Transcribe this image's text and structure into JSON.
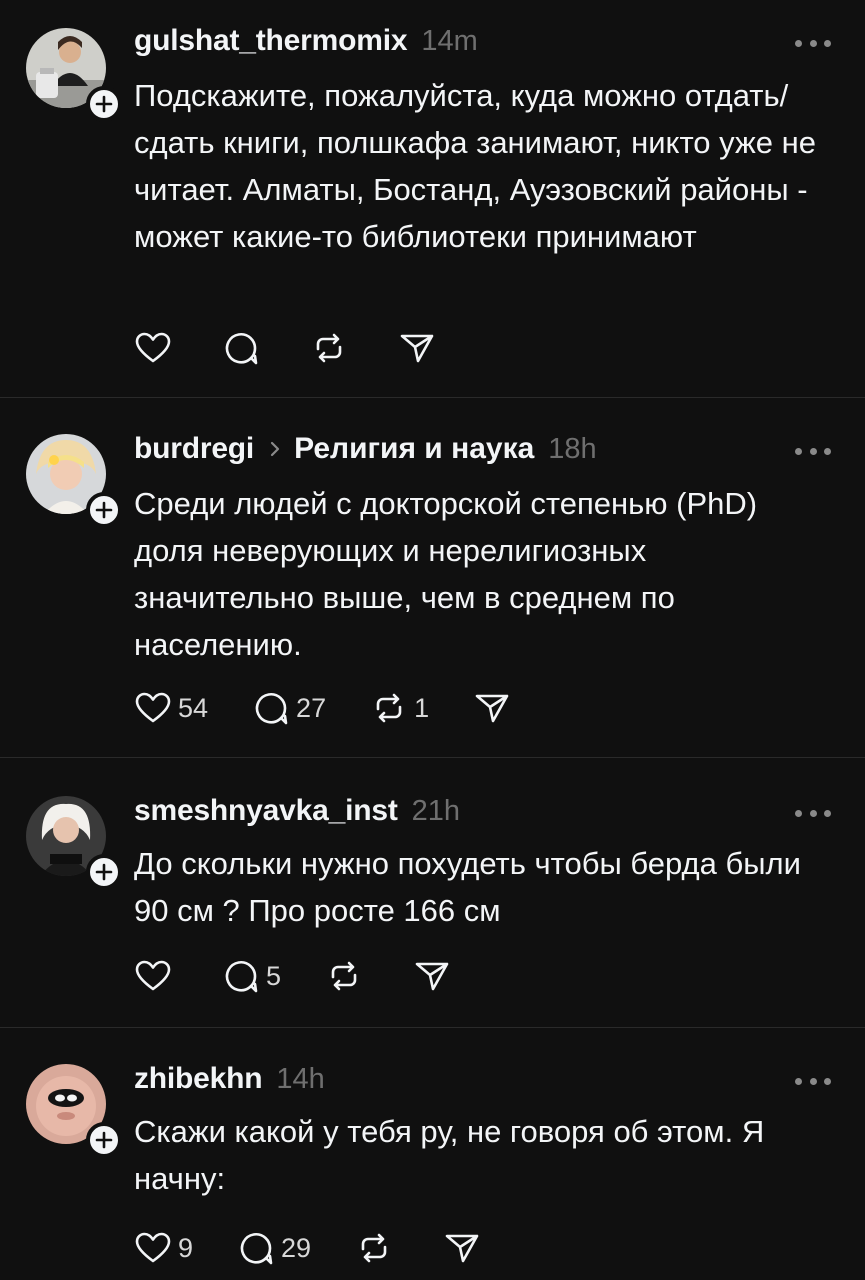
{
  "posts": [
    {
      "username": "gulshat_thermomix",
      "topic": "",
      "time": "14m",
      "text": "Подскажите, пожалуйста, куда можно отдать/сдать книги, полшкафа занимают, никто уже не читает. Алматы, Бостанд, Ауэзовский районы - может какие-то библиотеки принимают",
      "likes": "",
      "replies": "",
      "reposts": ""
    },
    {
      "username": "burdregi",
      "topic": "Религия и наука",
      "time": "18h",
      "text": "Среди людей с докторской степенью (PhD) доля неверующих и нерелигиозных значительно выше, чем в среднем по населению.",
      "likes": "54",
      "replies": "27",
      "reposts": "1"
    },
    {
      "username": "smeshnyavka_inst",
      "topic": "",
      "time": "21h",
      "text": "До скольки нужно похудеть чтобы берда были 90 см ? Про росте 166 см",
      "likes": "",
      "replies": "5",
      "reposts": ""
    },
    {
      "username": "zhibekhn",
      "topic": "",
      "time": "14h",
      "text": "Скажи какой у тебя ру, не говоря об этом. Я начну:",
      "likes": "9",
      "replies": "29",
      "reposts": ""
    }
  ],
  "icons": {
    "like": "heart-icon",
    "reply": "comment-icon",
    "repost": "repost-icon",
    "share": "send-icon",
    "follow": "plus-icon",
    "more": "more-icon"
  },
  "colors": {
    "background": "#101010",
    "text": "#f3f5f7",
    "muted": "#6f6f6f",
    "divider": "#2a2a2a"
  }
}
